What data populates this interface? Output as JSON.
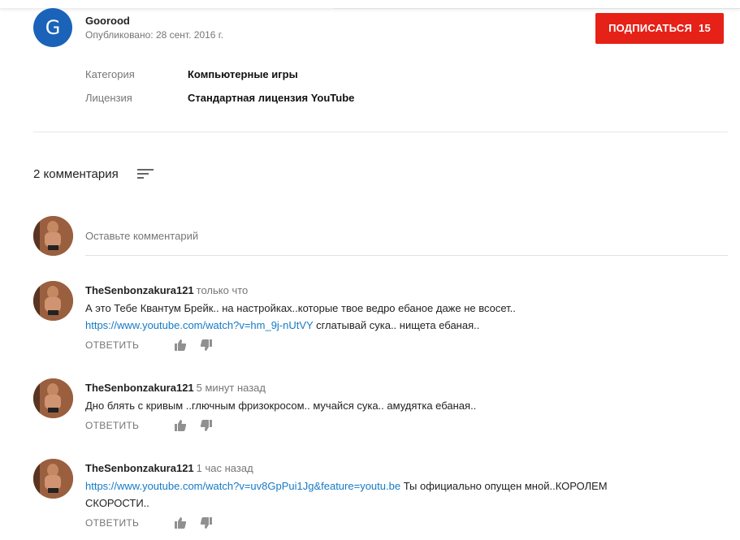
{
  "channel": {
    "avatar_letter": "G",
    "avatar_color": "#1a63b8",
    "name": "Goorood",
    "published": "Опубликовано: 28 сент. 2016 г.",
    "subscribe_label": "ПОДПИСАТЬСЯ",
    "subscriber_count": "15",
    "subscribe_color": "#e62117"
  },
  "meta": {
    "category_label": "Категория",
    "category_value": "Компьютерные игры",
    "license_label": "Лицензия",
    "license_value": "Стандартная лицензия YouTube"
  },
  "comments_header": {
    "count_text": "2 комментария",
    "sort_icon": "sort-icon"
  },
  "new_comment": {
    "placeholder": "Оставьте комментарий"
  },
  "comments": [
    {
      "author": "TheSenbonzakura121",
      "time": "только что",
      "line1": "А это Тебе Квантум Брейк.. на настройках..которые твое ведро ебаное даже не всосет..",
      "link": "https://www.youtube.com/watch?v=hm_9j-nUtVY",
      "after_link": " сглатывай сука.. нищета ебаная..",
      "reply_label": "ОТВЕТИТЬ"
    },
    {
      "author": "TheSenbonzakura121",
      "time": "5 минут назад",
      "line1": "Дно блять с кривым ..глючным фризокросом.. мучайся сука.. амудятка ебаная..",
      "reply_label": "ОТВЕТИТЬ"
    },
    {
      "author": "TheSenbonzakura121",
      "time": "1 час назад",
      "link": "https://www.youtube.com/watch?v=uv8GpPui1Jg&feature=youtu.be",
      "after_link": " Ты официально опущен мной..КОРОЛЕМ",
      "line2": "СКОРОСТИ..",
      "reply_label": "ОТВЕТИТЬ"
    }
  ]
}
